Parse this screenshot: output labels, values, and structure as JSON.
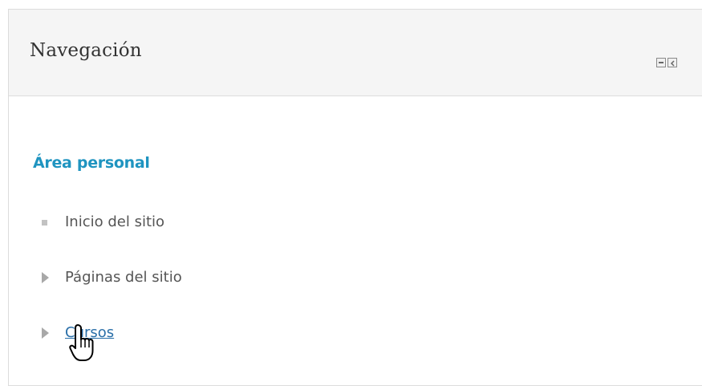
{
  "navigation_block": {
    "title": "Navegación",
    "controls": {
      "hide_icon": "minus-square-icon",
      "dock_icon": "dock-left-icon"
    },
    "root_link": "Área personal",
    "items": [
      {
        "label": "Inicio del sitio",
        "marker": "bullet-square-icon"
      },
      {
        "label": "Páginas del sitio",
        "marker": "triangle-right-icon"
      },
      {
        "label": "Cursos",
        "marker": "triangle-right-icon"
      }
    ]
  },
  "colors": {
    "link": "#1f94c0",
    "text": "#555555",
    "header_bg": "#f5f5f5",
    "border": "#dcdcdc"
  },
  "cursor": "hand-pointer-icon"
}
